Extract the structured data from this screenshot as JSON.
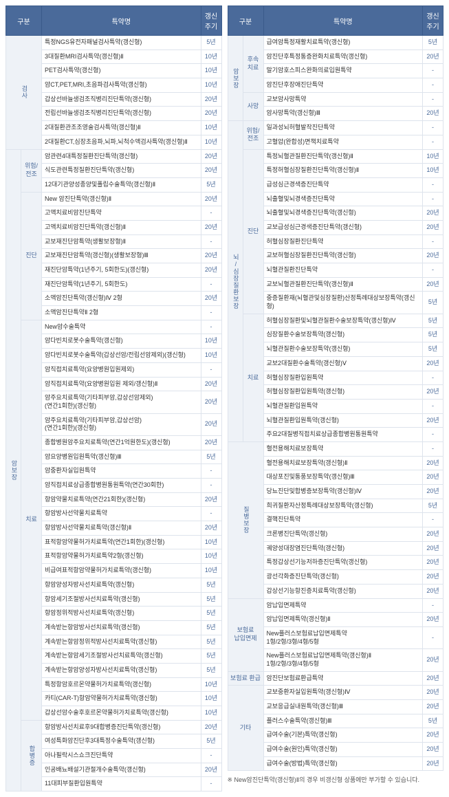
{
  "headers": {
    "gubun": "구분",
    "name": "특약명",
    "cycle": "갱신\n주기"
  },
  "note": "※ New암진단특약(갱신형)Ⅱ의 경우 비갱신형 상품에만 부가할 수 있습니다.",
  "left": [
    {
      "gubun": "검사",
      "gubunVertical": true,
      "sub": [
        {
          "items": [
            {
              "name": "특정NGS유전자패널검사특약(갱신형)",
              "cycle": "5년"
            },
            {
              "name": "3대질환MRI검사특약(갱신형)Ⅱ",
              "cycle": "10년"
            },
            {
              "name": "PET검사특약(갱신형)",
              "cycle": "10년"
            },
            {
              "name": "암CT,PET,MRI,초음파검사특약(갱신형)",
              "cycle": "10년"
            },
            {
              "name": "갑상선바늘생검조직병리진단특약(갱신형)",
              "cycle": "20년"
            },
            {
              "name": "전립선바늘생검조직병리진단특약(갱신형)",
              "cycle": "20년"
            },
            {
              "name": "2대질환관조조영술검사특약(갱신형)Ⅱ",
              "cycle": "10년"
            },
            {
              "name": "2대질환CT,심장초음파,뇌파,뇌척수액검사특약(갱신형)Ⅱ",
              "cycle": "10년"
            }
          ]
        }
      ]
    },
    {
      "gubun": "암보장",
      "gubunVertical": true,
      "sub": [
        {
          "label": "위험/\n전조",
          "items": [
            {
              "name": "암관련4대특정질환진단특약(갱신형)",
              "cycle": "20년"
            },
            {
              "name": "식도관련특정질환진단특약(갱신형)",
              "cycle": "20년"
            },
            {
              "name": "12대기관양성종양및폴립수술특약(갱신형)Ⅱ",
              "cycle": "5년"
            }
          ]
        },
        {
          "label": "진단",
          "items": [
            {
              "name": "New 암진단특약(갱신형)Ⅱ",
              "cycle": "20년"
            },
            {
              "name": "고액치료비암진단특약",
              "cycle": "-"
            },
            {
              "name": "고액치료비암진단특약(갱신형)Ⅱ",
              "cycle": "20년"
            },
            {
              "name": "교보재진단암특약(생활보장형)Ⅱ",
              "cycle": "-"
            },
            {
              "name": "교보재진단암특약(갱신형)(생활보장형)Ⅲ",
              "cycle": "20년"
            },
            {
              "name": "재진단암특약(1년주기, 5회한도)(갱신형)",
              "cycle": "20년"
            },
            {
              "name": "재진단암특약(1년주기, 5회한도)",
              "cycle": "-"
            },
            {
              "name": "소액암진단특약(갱신형)Ⅳ 2형",
              "cycle": "20년"
            },
            {
              "name": "소액암진단특약Ⅱ 2형",
              "cycle": "-"
            }
          ]
        },
        {
          "label": "치료",
          "items": [
            {
              "name": "New암수술특약",
              "cycle": "-"
            },
            {
              "name": "암다빈치로봇수술특약(갱신형)",
              "cycle": "10년"
            },
            {
              "name": "암다빈치로봇수술특약(갑상선암/전립선암제외)(갱신형)",
              "cycle": "10년"
            },
            {
              "name": "암직접치료특약(요양병원입원제외)",
              "cycle": "-"
            },
            {
              "name": "암직접치료특약(요양병원입원 제외/갱신형)Ⅱ",
              "cycle": "20년"
            },
            {
              "name": "암주요치료특약(기타피부암,갑상선암제외)\n(연간1회한)(갱신형)",
              "cycle": "20년"
            },
            {
              "name": "암주요치료특약(기타피부암,갑상선암)\n(연간1회한)(갱신형)",
              "cycle": "20년"
            },
            {
              "name": "종합병원암주요치료특약(연간1억원한도)(갱신형)",
              "cycle": "20년"
            },
            {
              "name": "암요양병원입원특약(갱신형)Ⅲ",
              "cycle": "5년"
            },
            {
              "name": "암중환자실입원특약",
              "cycle": "-"
            },
            {
              "name": "암직접치료상급종합병원통원특약(연간30회한)",
              "cycle": "-"
            },
            {
              "name": "항암약물치료특약(연간21회한)(갱신형)",
              "cycle": "20년"
            },
            {
              "name": "항암방사선약물치료특약",
              "cycle": "-"
            },
            {
              "name": "항암방사선약물치료특약(갱신형)Ⅱ",
              "cycle": "20년"
            },
            {
              "name": "표적항암약물허가치료특약(연간1회한)(갱신형)",
              "cycle": "10년"
            },
            {
              "name": "표적항암약물허가치료특약2형(갱신형)",
              "cycle": "10년"
            },
            {
              "name": "비급여표적항암약물허가치료특약(갱신형)",
              "cycle": "10년"
            },
            {
              "name": "항암양성자방사선치료특약(갱신형)",
              "cycle": "5년"
            },
            {
              "name": "항암세기조절방사선치료특약(갱신형)",
              "cycle": "5년"
            },
            {
              "name": "항암정위적방사선치료특약(갱신형)",
              "cycle": "5년"
            },
            {
              "name": "계속받는항암방사선치료특약(갱신형)",
              "cycle": "5년"
            },
            {
              "name": "계속받는항암정위적방사선치료특약(갱신형)",
              "cycle": "5년"
            },
            {
              "name": "계속받는항암세기조절방사선치료특약(갱신형)",
              "cycle": "5년"
            },
            {
              "name": "계속받는항암양성자방사선치료특약(갱신형)",
              "cycle": "5년"
            },
            {
              "name": "특정항암호르몬약물허가치료특약(갱신형)",
              "cycle": "10년"
            },
            {
              "name": "카티(CAR-T)항암약물허가치료특약(갱신형)",
              "cycle": "10년"
            },
            {
              "name": "갑상선암수술후호르몬약물허가치료특약(갱신형)",
              "cycle": "10년"
            }
          ]
        },
        {
          "label": "합병증",
          "labelVertical": true,
          "items": [
            {
              "name": "항암방사선치료후9대합병증진단특약(갱신형)",
              "cycle": "20년"
            },
            {
              "name": "여성특화암진단후3대특정수술특약(갱신형)",
              "cycle": "5년"
            },
            {
              "name": "아나필락시스쇼크진단특약",
              "cycle": "-"
            },
            {
              "name": "인공배뇨배설기관절개수술특약(갱신형)",
              "cycle": "20년"
            },
            {
              "name": "11대피부질환입원특약",
              "cycle": "-"
            }
          ]
        }
      ]
    }
  ],
  "right": [
    {
      "gubun": "암보장",
      "gubunVertical": true,
      "sub": [
        {
          "label": "후속\n치료",
          "items": [
            {
              "name": "급여암특정재활치료특약(갱신형)",
              "cycle": "5년"
            },
            {
              "name": "암진단후특정통증완화치료특약(갱신형)",
              "cycle": "20년"
            },
            {
              "name": "말기암호스피스완화의료입원특약",
              "cycle": "-"
            },
            {
              "name": "암진단후장애진단특약",
              "cycle": "-"
            }
          ]
        },
        {
          "label": "사망",
          "items": [
            {
              "name": "교보암사망특약",
              "cycle": "-"
            },
            {
              "name": "암사망특약(갱신형)Ⅲ",
              "cycle": "20년"
            }
          ]
        }
      ]
    },
    {
      "gubun": "뇌/심장질환보장",
      "gubunVertical": true,
      "sub": [
        {
          "label": "위험/\n전조",
          "items": [
            {
              "name": "일과성뇌허혈발작진단특약",
              "cycle": "-"
            },
            {
              "name": "고혈압(완합성)면책치료특약",
              "cycle": "-"
            }
          ]
        },
        {
          "label": "진단",
          "items": [
            {
              "name": "특정뇌혈관질환진단특약(갱신형)Ⅱ",
              "cycle": "10년"
            },
            {
              "name": "특정허혈심장질환진단특약(갱신형)Ⅱ",
              "cycle": "10년"
            },
            {
              "name": "급성심근경색증진단특약",
              "cycle": "-"
            },
            {
              "name": "뇌출혈및뇌경색증진단특약",
              "cycle": "-"
            },
            {
              "name": "뇌출혈및뇌경색증진단특약(갱신형)",
              "cycle": "20년"
            },
            {
              "name": "교보급성심근경색증진단특약(갱신형)",
              "cycle": "20년"
            },
            {
              "name": "허혈심장질환진단특약",
              "cycle": "-"
            },
            {
              "name": "교보허혈심장질환진단특약(갱신형)",
              "cycle": "20년"
            },
            {
              "name": "뇌혈관질환진단특약",
              "cycle": "-"
            },
            {
              "name": "교보뇌혈관질환진단특약(갱신형)Ⅱ",
              "cycle": "20년"
            },
            {
              "name": "중증질환재(뇌혈관및심장질환)산정특례대상보장특약(갱신형)",
              "cycle": "5년"
            }
          ]
        },
        {
          "label": "치료",
          "items": [
            {
              "name": "허혈심장질환및뇌혈관질환수술보장특약(갱신형)Ⅳ",
              "cycle": "5년"
            },
            {
              "name": "심장질환수술보장특약(갱신형)",
              "cycle": "5년"
            },
            {
              "name": "뇌혈관질환수술보장특약(갱신형)",
              "cycle": "5년"
            },
            {
              "name": "교보2대질환수술특약(갱신형)Ⅴ",
              "cycle": "20년"
            },
            {
              "name": "허혈심장질환입원특약",
              "cycle": "-"
            },
            {
              "name": "허혈심장질환입원특약(갱신형)",
              "cycle": "20년"
            },
            {
              "name": "뇌혈관질환입원특약",
              "cycle": "-"
            },
            {
              "name": "뇌혈관질환입원특약(갱신형)",
              "cycle": "20년"
            },
            {
              "name": "주요2대질병직접치료상급종합병원통원특약",
              "cycle": "-"
            }
          ]
        }
      ]
    },
    {
      "gubun": "질병보장",
      "gubunVertical": true,
      "sub": [
        {
          "items": [
            {
              "name": "혈전용해치료보장특약",
              "cycle": "-"
            },
            {
              "name": "혈전용해치료보장특약(갱신형)Ⅱ",
              "cycle": "20년"
            },
            {
              "name": "대상포진및통풍보장특약(갱신형)Ⅲ",
              "cycle": "20년"
            },
            {
              "name": "당뇨진단및합병증보장특약(갱신형)Ⅳ",
              "cycle": "20년"
            },
            {
              "name": "희귀질환자산정특례대상보장특약(갱신형)",
              "cycle": "5년"
            },
            {
              "name": "결핵진단특약",
              "cycle": "-"
            },
            {
              "name": "크론병진단특약(갱신형)",
              "cycle": "20년"
            },
            {
              "name": "궤양성대장염진단특약(갱신형)",
              "cycle": "20년"
            },
            {
              "name": "특정갑상선기능저하증진단특약(갱신형)",
              "cycle": "20년"
            },
            {
              "name": "광선각화증진단특약(갱신형)",
              "cycle": "20년"
            },
            {
              "name": "갑상선기능항진증치료특약(갱신형)",
              "cycle": "20년"
            }
          ]
        }
      ]
    },
    {
      "gubun": "보험료\n납입면제",
      "sub": [
        {
          "items": [
            {
              "name": "암납입면제특약",
              "cycle": "-"
            },
            {
              "name": "암납입면제특약(갱신형)Ⅱ",
              "cycle": "20년"
            },
            {
              "name": "New플러스보험료납입면제특약\n1형/2형/3형/4형/5형",
              "cycle": "-"
            },
            {
              "name": "New플러스보험료납입면제특약(갱신형)Ⅱ\n1형/2형/3형/4형/5형",
              "cycle": "20년"
            }
          ]
        }
      ]
    },
    {
      "gubun": "보험료 환급",
      "sub": [
        {
          "items": [
            {
              "name": "암진단보험료환급특약",
              "cycle": "20년"
            }
          ]
        }
      ]
    },
    {
      "gubun": "기타",
      "sub": [
        {
          "items": [
            {
              "name": "교보중환자실입원특약(갱신형)Ⅳ",
              "cycle": "20년"
            },
            {
              "name": "교보응급실내원특약(갱신형)Ⅲ",
              "cycle": "20년"
            },
            {
              "name": "플러스수술특약(갱신형)Ⅲ",
              "cycle": "5년"
            },
            {
              "name": "급여수술(기본)특약(갱신형)",
              "cycle": "20년"
            },
            {
              "name": "급여수술(원인)특약(갱신형)",
              "cycle": "20년"
            },
            {
              "name": "급여수술(방법)특약(갱신형)",
              "cycle": "20년"
            }
          ]
        }
      ]
    }
  ]
}
